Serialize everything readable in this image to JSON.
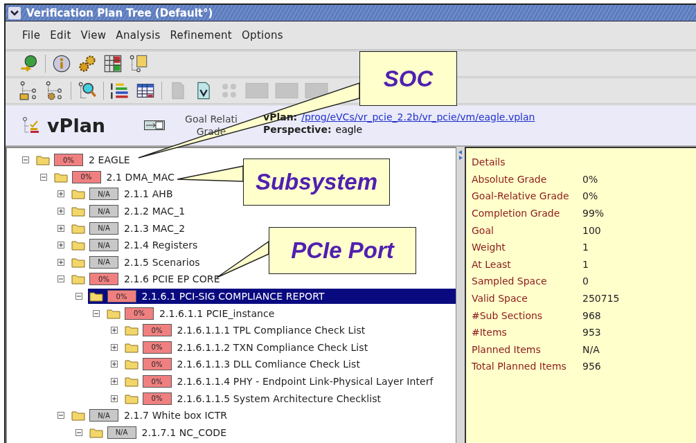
{
  "window": {
    "title": "Verification Plan Tree (Default°)"
  },
  "menu": [
    "File",
    "Edit",
    "View",
    "Analysis",
    "Refinement",
    "Options"
  ],
  "toolbar_1": [
    {
      "kind": "globe",
      "disabled": false
    },
    {
      "kind": "info",
      "disabled": false
    },
    {
      "kind": "gears",
      "disabled": false
    },
    {
      "kind": "grid",
      "disabled": false
    },
    {
      "kind": "treedoc",
      "disabled": false
    }
  ],
  "toolbar_2": [
    {
      "kind": "treefolder",
      "disabled": false
    },
    {
      "kind": "treegear",
      "disabled": false
    },
    {
      "kind": "treesearch",
      "disabled": false
    },
    {
      "kind": "bars",
      "disabled": false
    },
    {
      "kind": "table",
      "disabled": false
    },
    {
      "kind": "doc",
      "disabled": true
    },
    {
      "kind": "vdoc",
      "disabled": false
    },
    {
      "kind": "dots",
      "disabled": true
    },
    {
      "kind": "box",
      "disabled": true
    },
    {
      "kind": "box",
      "disabled": true
    },
    {
      "kind": "box",
      "disabled": true
    }
  ],
  "header": {
    "title": "vPlan",
    "grade_label": [
      "Goal Relati",
      "Grade"
    ],
    "vplan_label": "vPlan:",
    "vplan_path": "/prog/eVCs/vr_pcie_2.2b/vr_pcie/vm/eagle.vplan",
    "perspective_label": "Perspective:",
    "perspective": "eagle"
  },
  "tree": [
    {
      "badge": "0%",
      "color": "#f08080",
      "label": "2 EAGLE",
      "expanded": true,
      "selected": false,
      "children": [
        {
          "badge": "0%",
          "color": "#f08080",
          "label": "2.1 DMA_MAC",
          "expanded": true,
          "selected": false,
          "children": [
            {
              "badge": "N/A",
              "color": "#c8c8c8",
              "label": "2.1.1 AHB",
              "expanded": false,
              "selected": false
            },
            {
              "badge": "N/A",
              "color": "#c8c8c8",
              "label": "2.1.2 MAC_1",
              "expanded": false,
              "selected": false
            },
            {
              "badge": "N/A",
              "color": "#c8c8c8",
              "label": "2.1.3 MAC_2",
              "expanded": false,
              "selected": false
            },
            {
              "badge": "N/A",
              "color": "#c8c8c8",
              "label": "2.1.4 Registers",
              "expanded": false,
              "selected": false
            },
            {
              "badge": "N/A",
              "color": "#c8c8c8",
              "label": "2.1.5 Scenarios",
              "expanded": false,
              "selected": false
            },
            {
              "badge": "0%",
              "color": "#f08080",
              "label": "2.1.6 PCIE EP CORE",
              "expanded": true,
              "selected": false,
              "children": [
                {
                  "badge": "0%",
                  "color": "#f08080",
                  "label": "2.1.6.1  PCI-SIG COMPLIANCE REPORT",
                  "expanded": true,
                  "selected": true,
                  "children": [
                    {
                      "badge": "0%",
                      "color": "#f08080",
                      "label": "2.1.6.1.1 PCIE_instance",
                      "expanded": true,
                      "selected": false,
                      "children": [
                        {
                          "badge": "0%",
                          "color": "#f08080",
                          "label": "2.1.6.1.1.1 TPL Compliance Check List",
                          "expanded": false,
                          "selected": false
                        },
                        {
                          "badge": "0%",
                          "color": "#f08080",
                          "label": "2.1.6.1.1.2 TXN Compliance Check List",
                          "expanded": false,
                          "selected": false
                        },
                        {
                          "badge": "0%",
                          "color": "#f08080",
                          "label": "2.1.6.1.1.3 DLL Comliance Check List",
                          "expanded": false,
                          "selected": false
                        },
                        {
                          "badge": "0%",
                          "color": "#f08080",
                          "label": "2.1.6.1.1.4 PHY - Endpoint Link-Physical Layer Interf",
                          "expanded": false,
                          "selected": false
                        },
                        {
                          "badge": "0%",
                          "color": "#f08080",
                          "label": "2.1.6.1.1.5 System Architecture Checklist",
                          "expanded": false,
                          "selected": false
                        }
                      ]
                    }
                  ]
                }
              ]
            },
            {
              "badge": "N/A",
              "color": "#c8c8c8",
              "label": "2.1.7 White box ICTR",
              "expanded": true,
              "selected": false,
              "children": [
                {
                  "badge": "N/A",
                  "color": "#c8c8c8",
                  "label": "2.1.7.1 NC_CODE",
                  "expanded": true,
                  "selected": false
                }
              ]
            }
          ]
        }
      ]
    }
  ],
  "details": {
    "title": "Details",
    "rows": [
      {
        "label": "Absolute Grade",
        "value": "0%"
      },
      {
        "label": "Goal-Relative Grade",
        "value": "0%"
      },
      {
        "label": "Completion Grade",
        "value": "99%"
      },
      {
        "label": "Goal",
        "value": "100"
      },
      {
        "label": "Weight",
        "value": "1"
      },
      {
        "label": "At Least",
        "value": "1"
      },
      {
        "label": "Sampled Space",
        "value": "0"
      },
      {
        "label": "Valid Space",
        "value": "250715"
      },
      {
        "label": "#Sub Sections",
        "value": "968"
      },
      {
        "label": "#Items",
        "value": "953"
      },
      {
        "label": "Planned Items",
        "value": "N/A"
      },
      {
        "label": "Total Planned Items",
        "value": "956"
      }
    ]
  },
  "callouts": [
    {
      "text": "SOC"
    },
    {
      "text": "Subsystem"
    },
    {
      "text": "PCIe Port"
    }
  ]
}
